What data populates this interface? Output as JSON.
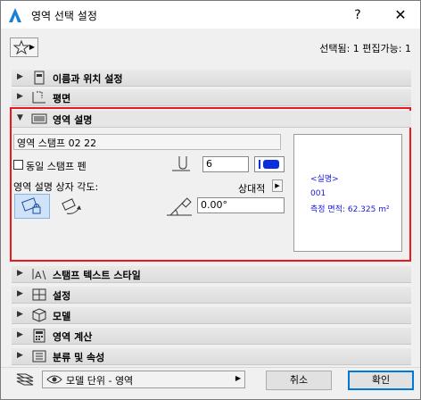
{
  "window": {
    "title": "영역 선택 설정",
    "help_label": "?",
    "close_label": "✕"
  },
  "toolbar": {
    "selection_status": "선택됨: 1 편집가능: 1"
  },
  "sections": {
    "name_position": "이름과 위치 설정",
    "floor_plan": "평면",
    "zone_stamp": "영역 설명",
    "stamp_text_style": "스탬프 텍스트 스타일",
    "settings": "설정",
    "model": "모델",
    "zone_calc": "영역 계산",
    "classification": "분류 및 속성"
  },
  "zone_stamp": {
    "stamp_name": "영역 스탬프 02 22",
    "same_pen_label": "동일 스탬프 펜",
    "same_pen_checked": false,
    "pen_number": "6",
    "pen_color": "#0a2ee0",
    "angle_label": "영역 설명 상자 각도:",
    "relative_label": "상대적",
    "angle_value": "0.00°",
    "preview": {
      "line1": "<실명>",
      "line2": "001",
      "line3": "측정 면적: 62.325 m²"
    }
  },
  "footer": {
    "view_value": "모델 단위 - 영역",
    "cancel_label": "취소",
    "ok_label": "확인"
  }
}
